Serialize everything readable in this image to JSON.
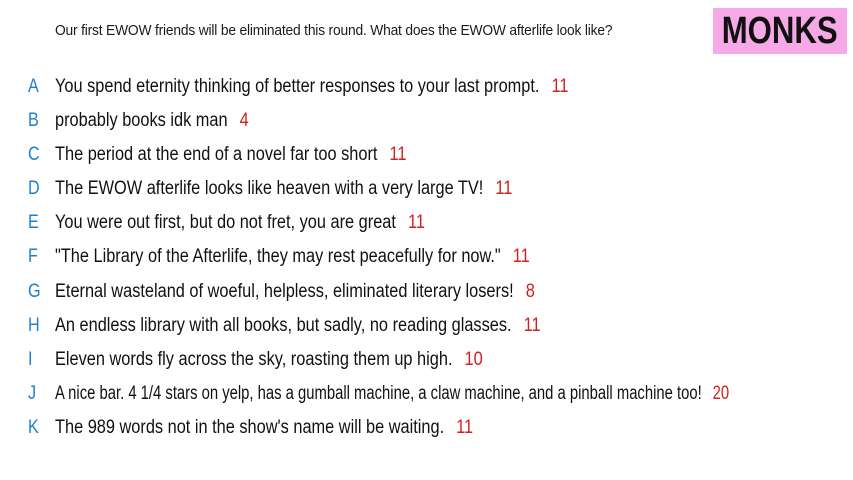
{
  "prompt": "Our first EWOW friends will be eliminated this round. What does the EWOW afterlife look like?",
  "badge": "MONKS",
  "colors": {
    "letter": "#1e7fd0",
    "count": "#d21f1f",
    "badge_bg": "#f7a8e6"
  },
  "responses": [
    {
      "letter": "A",
      "text": "You spend eternity thinking of better responses to your last prompt.",
      "count": "11"
    },
    {
      "letter": "B",
      "text": "probably books idk man",
      "count": "4"
    },
    {
      "letter": "C",
      "text": "The period at the end of a novel far too short",
      "count": "11"
    },
    {
      "letter": "D",
      "text": "The EWOW afterlife looks like heaven with a very large TV!",
      "count": "11"
    },
    {
      "letter": "E",
      "text": "You were out first, but do not fret, you are great",
      "count": "11"
    },
    {
      "letter": "F",
      "text": "\"The Library of the Afterlife, they may rest peacefully for now.\"",
      "count": "11"
    },
    {
      "letter": "G",
      "text": "Eternal wasteland of woeful, helpless, eliminated literary losers!",
      "count": "8"
    },
    {
      "letter": "H",
      "text": "An endless library with all books, but sadly, no reading glasses.",
      "count": "11"
    },
    {
      "letter": "I",
      "text": "Eleven words fly across the sky, roasting them up high.",
      "count": "10"
    },
    {
      "letter": "J",
      "text": "A nice bar. 4 1/4 stars on yelp, has a gumball machine, a claw machine, and a pinball machine too!",
      "count": "20"
    },
    {
      "letter": "K",
      "text": "The 989 words not in the show's name will be waiting.",
      "count": "11"
    }
  ]
}
